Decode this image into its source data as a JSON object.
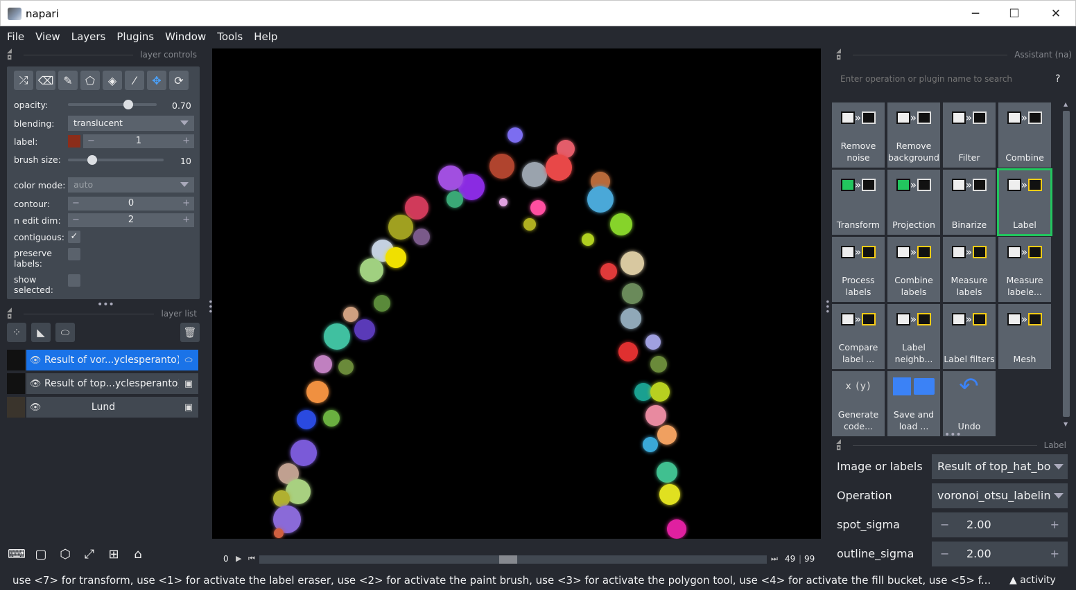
{
  "window": {
    "title": "napari",
    "minimize": "─",
    "maximize": "☐",
    "close": "✕"
  },
  "menu": [
    "File",
    "View",
    "Layers",
    "Plugins",
    "Window",
    "Tools",
    "Help"
  ],
  "layer_controls": {
    "title": "layer controls",
    "opacity_label": "opacity:",
    "opacity_value": "0.70",
    "opacity_fraction": 0.7,
    "blending_label": "blending:",
    "blending_value": "translucent",
    "label_label": "label:",
    "label_value": "1",
    "label_color": "#8b2d1a",
    "brush_label": "brush size:",
    "brush_value": "10",
    "brush_fraction": 0.1,
    "color_mode_label": "color mode:",
    "color_mode_value": "auto",
    "contour_label": "contour:",
    "contour_value": "0",
    "n_edit_label": "n edit dim:",
    "n_edit_value": "2",
    "contiguous_label": "contiguous:",
    "contiguous_checked": "✓",
    "preserve_label_1": "preserve",
    "preserve_label_2": "labels:",
    "show_label_1": "show",
    "show_label_2": "selected:"
  },
  "layer_list": {
    "title": "layer list",
    "layers": [
      {
        "name": "Result of vor...yclesperanto)",
        "type_icon": "tag-icon",
        "type_glyph": "⬭",
        "selected": true
      },
      {
        "name": "Result of top...yclesperanto)",
        "type_icon": "image-icon",
        "type_glyph": "▣",
        "selected": false
      },
      {
        "name": "Lund",
        "type_icon": "image-icon",
        "type_glyph": "▣",
        "selected": false
      }
    ],
    "eye": "👁"
  },
  "dims": {
    "start": "0",
    "current": "49",
    "total": "99",
    "position_fraction": 0.49
  },
  "assistant": {
    "title": "Assistant (na)",
    "search_placeholder": "Enter operation or plugin name to search",
    "help": "?",
    "tiles": [
      {
        "label": "Remove noise"
      },
      {
        "label": "Remove background"
      },
      {
        "label": "Filter"
      },
      {
        "label": "Combine"
      },
      {
        "label": "Transform"
      },
      {
        "label": "Projection"
      },
      {
        "label": "Binarize"
      },
      {
        "label": "Label"
      },
      {
        "label": "Process labels"
      },
      {
        "label": "Combine labels"
      },
      {
        "label": "Measure labels"
      },
      {
        "label": "Measure labele..."
      },
      {
        "label": "Compare label ..."
      },
      {
        "label": "Label neighb..."
      },
      {
        "label": "Label filters"
      },
      {
        "label": "Mesh"
      },
      {
        "label": "Generate code..."
      },
      {
        "label": "Save and load ..."
      },
      {
        "label": "Undo"
      }
    ],
    "generate_icon_text": "x (y)"
  },
  "label_panel": {
    "title": "Label",
    "image_label": "Image or labels",
    "image_value": "Result of top_hat_bo",
    "operation_label": "Operation",
    "operation_value": "voronoi_otsu_labelin",
    "spot_label": "spot_sigma",
    "spot_value": "2.00",
    "outline_label": "outline_sigma",
    "outline_value": "2.00"
  },
  "status": {
    "text": "use <7> for transform, use <1> for activate the label eraser, use <2> for activate the paint brush, use <3> for activate the polygon tool, use <4> for activate the fill bucket, use <5> f...",
    "activity": "▲ activity"
  }
}
